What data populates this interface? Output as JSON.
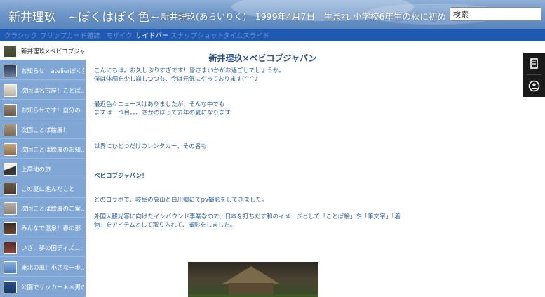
{
  "header": {
    "title": "新井理玖　~ぼくはぼく色~",
    "description": "新井理玖(あらいりく)　1999年4月7日　生まれ 小学校6年生の秋に初め...",
    "search_placeholder": "検索"
  },
  "tabs": [
    {
      "label": "クラシック",
      "active": false
    },
    {
      "label": "フリップカード",
      "active": false
    },
    {
      "label": "雑誌",
      "active": false
    },
    {
      "label": "モザイク",
      "active": false
    },
    {
      "label": "サイドバー",
      "active": true
    },
    {
      "label": "スナップショット",
      "active": false
    },
    {
      "label": "タイムスライド",
      "active": false
    }
  ],
  "sidebar": {
    "items": [
      {
        "label": "新井理玖×ベビコブジャパン",
        "active": true
      },
      {
        "label": "お知らせ　atelierぼく色...",
        "active": false
      },
      {
        "label": "次回は名古屋！ことば...",
        "active": false
      },
      {
        "label": "お知らせです！自分の...",
        "active": false
      },
      {
        "label": "次回ことば絵展！",
        "active": false
      },
      {
        "label": "次回ことば絵展のお知...",
        "active": false
      },
      {
        "label": "上高地の旅",
        "active": false
      },
      {
        "label": "この夏に進んだこと",
        "active": false
      },
      {
        "label": "次回ことば絵展のご案...",
        "active": false
      },
      {
        "label": "みんなで温泉！春の部",
        "active": false
      },
      {
        "label": "いざ、夢の国ディズニ...",
        "active": false
      },
      {
        "label": "東北の風！小さな一歩...",
        "active": false
      },
      {
        "label": "公園でサッカー＊＊男の...",
        "active": false
      }
    ]
  },
  "post": {
    "title": "新井理玖×ベビコブジャパン",
    "p1": "こんにちは。お久しぶりすぎです！皆さまいかがお過ごしでしょうか。",
    "p2": "僕は体調を少し崩しつつも、今は元気にやっております(^^♪",
    "p3": "最近色々ニュースはありましたが、そんな中でも",
    "p4": "まずは一つ目。。。さかのぼって去年の夏になります",
    "p5": "世界にひとつだけのレンタカー、その名も",
    "p6": "ベビコブジャパン！",
    "p7": "とのコラボで、岐阜の高山と白川郷にてpv撮影をしてきました。",
    "p8": "外国人観光客に向けたインバウンド事業なので、日本を打ちだす和のイメージとして「ことば絵」や「筆文字」「着",
    "p9": "物」をアイテムとして取り入れて、撮影をしました。"
  },
  "colors": {
    "tab_bar": "#1f59b2",
    "sidebar": "#7fa6d4",
    "text_blue": "#2a5fa3",
    "title_blue": "#2a4f85"
  },
  "icons": {
    "fab_top": "share-icon",
    "fab_bottom": "account-icon"
  }
}
